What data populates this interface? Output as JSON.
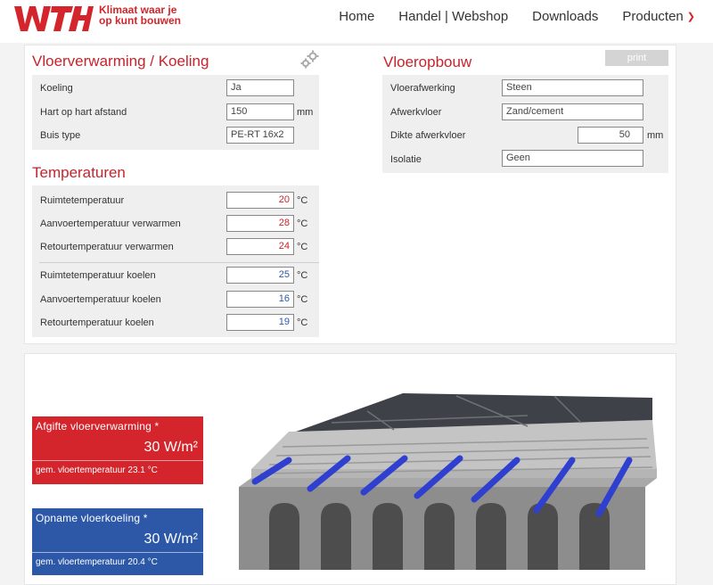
{
  "brand": {
    "logo": "WTH",
    "tagline_line1": "Klimaat waar je",
    "tagline_line2": "op kunt bouwen",
    "red": "#d3252b",
    "blue": "#2d58a8"
  },
  "nav": {
    "items": [
      {
        "label": "Home"
      },
      {
        "label": "Handel | Webshop"
      },
      {
        "label": "Downloads"
      },
      {
        "label": "Producten",
        "icon": "chevron-down-icon"
      }
    ]
  },
  "vloerverwarming": {
    "title": "Vloerverwarming / Koeling",
    "icon": "gear-icon",
    "rows": [
      {
        "label": "Koeling",
        "value": "Ja",
        "unit": ""
      },
      {
        "label": "Hart op hart afstand",
        "value": "150",
        "unit": "mm"
      },
      {
        "label": "Buis type",
        "value": "PE-RT 16x2",
        "unit": ""
      }
    ]
  },
  "vloeropbouw": {
    "title": "Vloeropbouw",
    "print_label": "print",
    "rows": [
      {
        "label": "Vloerafwerking",
        "value": "Steen",
        "unit": ""
      },
      {
        "label": "Afwerkvloer",
        "value": "Zand/cement",
        "unit": ""
      },
      {
        "label": "Dikte afwerkvloer",
        "value": "50",
        "unit": "mm"
      },
      {
        "label": "Isolatie",
        "value": "Geen",
        "unit": ""
      }
    ]
  },
  "temperaturen": {
    "title": "Temperaturen",
    "warm_rows": [
      {
        "label": "Ruimtetemperatuur",
        "value": "20",
        "unit": "°C"
      },
      {
        "label": "Aanvoertemperatuur verwarmen",
        "value": "28",
        "unit": "°C"
      },
      {
        "label": "Retourtemperatuur verwarmen",
        "value": "24",
        "unit": "°C"
      }
    ],
    "cool_rows": [
      {
        "label": "Ruimtetemperatuur koelen",
        "value": "25",
        "unit": "°C"
      },
      {
        "label": "Aanvoertemperatuur koelen",
        "value": "16",
        "unit": "°C"
      },
      {
        "label": "Retourtemperatuur koelen",
        "value": "19",
        "unit": "°C"
      }
    ]
  },
  "results": {
    "heating": {
      "title": "Afgifte vloerverwarming *",
      "value": "30 W/m²",
      "sub": "gem. vloertemperatuur 23.1 °C"
    },
    "cooling": {
      "title": "Opname vloerkoeling *",
      "value": "30 W/m²",
      "sub": "gem. vloertemperatuur 20.4 °C"
    }
  }
}
